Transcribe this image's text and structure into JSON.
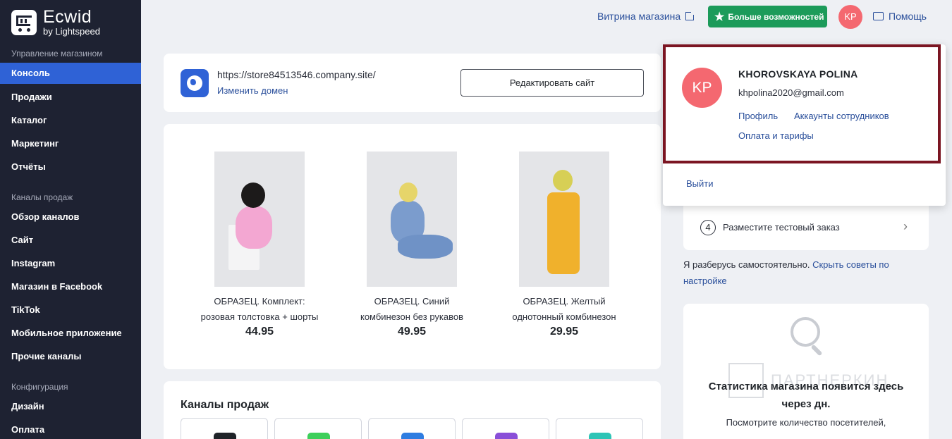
{
  "brand": {
    "name": "Ecwid",
    "sub": "by Lightspeed"
  },
  "sidebar": {
    "sections": [
      {
        "label": "Управление магазином"
      },
      {
        "label": "Каналы продаж"
      },
      {
        "label": "Конфигурация"
      }
    ],
    "items": [
      {
        "label": "Консоль"
      },
      {
        "label": "Продажи"
      },
      {
        "label": "Каталог"
      },
      {
        "label": "Маркетинг"
      },
      {
        "label": "Отчёты"
      },
      {
        "label": "Обзор каналов"
      },
      {
        "label": "Сайт"
      },
      {
        "label": "Instagram"
      },
      {
        "label": "Магазин в Facebook"
      },
      {
        "label": "TikTok"
      },
      {
        "label": "Мобильное приложение"
      },
      {
        "label": "Прочие каналы"
      },
      {
        "label": "Дизайн"
      },
      {
        "label": "Оплата"
      }
    ]
  },
  "topbar": {
    "storefront": "Витрина магазина",
    "more": "Больше возможностей",
    "avatar": "KP",
    "help": "Помощь"
  },
  "site": {
    "url": "https://store84513546.company.site/",
    "change_domain": "Изменить домен",
    "edit_button": "Редактировать сайт"
  },
  "products": [
    {
      "title_line1": "ОБРАЗЕЦ. Комплект:",
      "title_line2": "розовая толстовка + шорты",
      "price": "44.95"
    },
    {
      "title_line1": "ОБРАЗЕЦ. Синий",
      "title_line2": "комбинезон без рукавов",
      "price": "49.95"
    },
    {
      "title_line1": "ОБРАЗЕЦ. Желтый",
      "title_line2": "однотонный комбинезон",
      "price": "29.95"
    }
  ],
  "channels": {
    "title": "Каналы продаж"
  },
  "setup": {
    "step_number": "4",
    "step_text": "Разместите тестовый заказ",
    "self_note": "Я разберусь самостоятельно.",
    "hide_tips": "Скрыть советы по настройке"
  },
  "stats": {
    "title": "Статистика магазина появится здесь через дн.",
    "subtitle": "Посмотрите количество посетителей,"
  },
  "watermark": "ПАРТНЕРКИН",
  "account_menu": {
    "avatar": "KP",
    "name": "KHOROVSKAYA POLINA",
    "email": "khpolina2020@gmail.com",
    "profile": "Профиль",
    "staff": "Аккаунты сотрудников",
    "billing": "Оплата и тарифы",
    "logout": "Выйти"
  },
  "colors": {
    "sidebar_bg": "#1e2232",
    "active_item": "#2f62d6",
    "more_button": "#1c9b5a",
    "avatar": "#f46870",
    "highlight_frame": "#7b1522",
    "link": "#2a4f9b"
  }
}
